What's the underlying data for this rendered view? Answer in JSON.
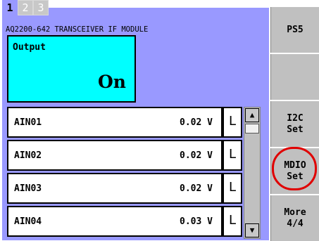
{
  "tabs": [
    {
      "label": "1",
      "active": true
    },
    {
      "label": "2",
      "active": false
    },
    {
      "label": "3",
      "active": false
    }
  ],
  "module_title": "AQ2200-642 TRANSCEIVER IF MODULE",
  "output": {
    "label": "Output",
    "value": "On"
  },
  "ain_rows": [
    {
      "name": "AIN01",
      "value": "0.02 V",
      "flag": "L"
    },
    {
      "name": "AIN02",
      "value": "0.02 V",
      "flag": "L"
    },
    {
      "name": "AIN03",
      "value": "0.02 V",
      "flag": "L"
    },
    {
      "name": "AIN04",
      "value": "0.03 V",
      "flag": "L"
    }
  ],
  "scrollbar": {
    "up": "▲",
    "down": "▼"
  },
  "side_buttons": [
    {
      "label": "PS5"
    },
    {
      "label": ""
    },
    {
      "label": "I2C\nSet"
    },
    {
      "label": "MDIO\nSet"
    },
    {
      "label": "More\n4/4"
    }
  ],
  "colors": {
    "panel": "#9999ff",
    "output_bg": "#00ffff",
    "highlight": "#e00000",
    "side_button": "#c0c0c0"
  }
}
